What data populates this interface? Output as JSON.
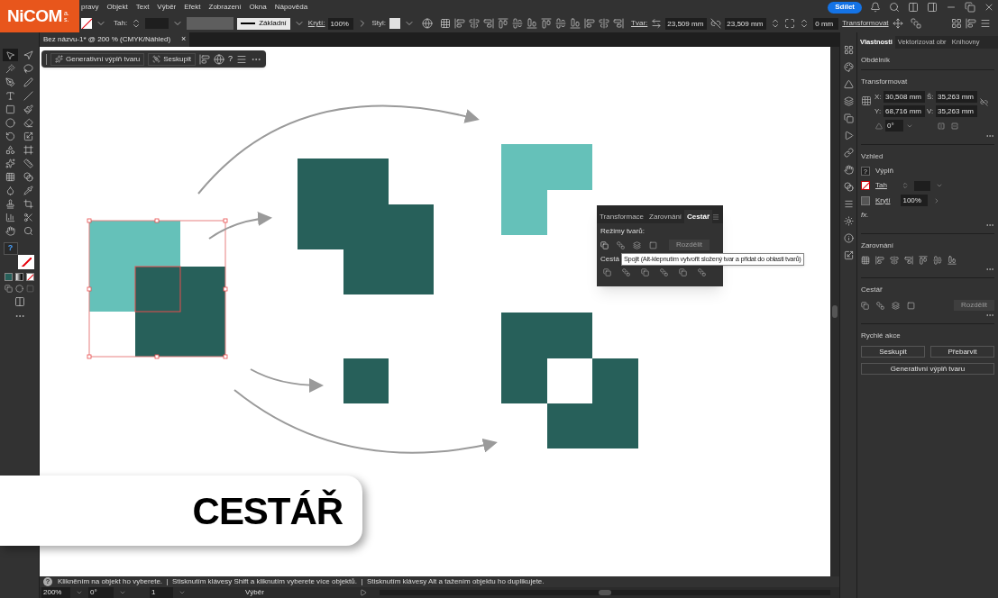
{
  "logo": {
    "name": "NiCOM",
    "suffix": "a.s."
  },
  "menu": [
    "pravy",
    "Objekt",
    "Text",
    "Výběr",
    "Efekt",
    "Zobrazení",
    "Okna",
    "Nápověda"
  ],
  "share_button": "Sdílet",
  "control_bar": {
    "stroke_label": "Tah:",
    "line_style": "Základní",
    "opacity_label": "Krytí:",
    "opacity": "100%",
    "style_label": "Styl:",
    "shape_label": "Tvar:",
    "width": "23,509 mm",
    "height": "23,509 mm",
    "corner": "0 mm",
    "transform": "Transformovat"
  },
  "document_tab": {
    "title": "Bez názvu-1* @ 200 % (CMYK/Náhled)",
    "close": "×"
  },
  "context_bar": {
    "buttons": [
      "Generativní výplň tvaru",
      "Seskupit"
    ],
    "help": "?"
  },
  "tools": [
    {
      "selected": true
    },
    {
      "selected": false
    },
    {
      "selected": false
    },
    {
      "selected": false
    },
    {
      "selected": false
    },
    {
      "selected": false
    },
    {
      "selected": false
    },
    {
      "selected": false
    },
    {
      "selected": false
    },
    {
      "selected": false
    },
    {
      "selected": false
    },
    {
      "selected": false
    },
    {
      "selected": false
    },
    {
      "selected": false
    },
    {
      "selected": false
    },
    {
      "selected": false
    },
    {
      "selected": false
    },
    {
      "selected": false
    },
    {
      "selected": false
    },
    {
      "selected": false
    },
    {
      "selected": false
    },
    {
      "selected": false
    },
    {
      "selected": false
    },
    {
      "selected": false
    },
    {
      "selected": false
    },
    {
      "selected": false
    },
    {
      "selected": false
    },
    {
      "selected": false
    }
  ],
  "fill_swatch": "?",
  "floating_panel": {
    "tabs": [
      {
        "label": "Transformace",
        "selected": false
      },
      {
        "label": "Zarovnání",
        "selected": false
      },
      {
        "label": "Cestář",
        "selected": true
      }
    ],
    "shape_modes_label": "Režimy tvarů:",
    "expand_button": {
      "label": "Rozdělit",
      "disabled": true
    },
    "pathfinders_label": "Cestá",
    "tooltip": "Spojit (Alt-klepnutím vytvořit složený tvar a přidat do oblasti tvarů)"
  },
  "properties": {
    "tabs": [
      {
        "label": "Vlastnosti",
        "selected": true
      },
      {
        "label": "Vektorizovat obr",
        "selected": false
      },
      {
        "label": "Knihovny",
        "selected": false
      }
    ],
    "object_type": "Obdélník",
    "transform": {
      "title": "Transformovat",
      "x_label": "X:",
      "x": "30,508 mm",
      "w_label": "Š:",
      "w": "35,263 mm",
      "y_label": "Y:",
      "y": "68,716 mm",
      "h_label": "V:",
      "h": "35,263 mm",
      "angle": "0°"
    },
    "appearance": {
      "title": "Vzhled",
      "fill_icon": "?",
      "fill_label": "Výplň",
      "stroke_label": "Tah",
      "opacity_label": "Krytí",
      "opacity": "100%",
      "fx": "fx."
    },
    "align": {
      "title": "Zarovnání"
    },
    "pathfinder": {
      "title": "Cestář",
      "expand_button": {
        "label": "Rozdělit",
        "disabled": true
      }
    },
    "quick_actions": {
      "title": "Rychlé akce",
      "buttons": [
        "Seskupit",
        "Přebarvit",
        "Generativní výplň tvaru"
      ]
    }
  },
  "status_bar": {
    "help": "?",
    "message": "Klikněním na objekt ho vyberete.  |  Stisknutím klávesy Shift a kliknutím vyberete více objektů.  |  Stisknutím klávesy Alt a tažením objektu ho duplikujete."
  },
  "bottom_bar": {
    "zoom": "200%",
    "rotation": "0°",
    "artboard": "1",
    "tool": "Výběr"
  },
  "title_banner": "CESTÁŘ"
}
